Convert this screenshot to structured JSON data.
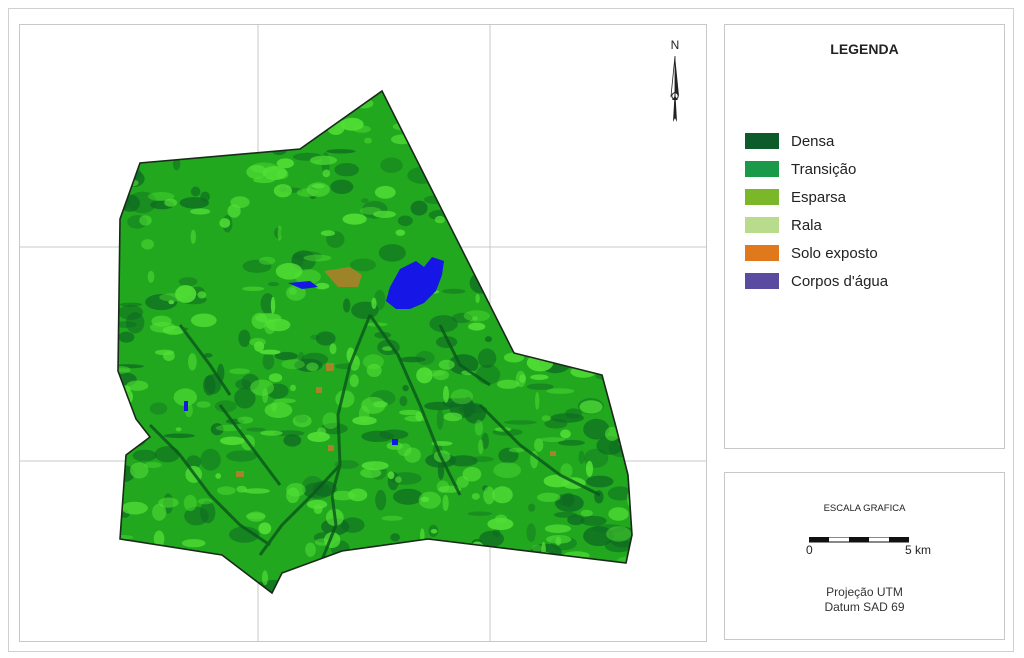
{
  "north_arrow": {
    "letter": "N"
  },
  "legend": {
    "title": "LEGENDA",
    "items": [
      {
        "label": "Densa",
        "color": "#0d5a2a"
      },
      {
        "label": "Transição",
        "color": "#1a9a48"
      },
      {
        "label": "Esparsa",
        "color": "#7ab829"
      },
      {
        "label": "Rala",
        "color": "#b8dc8c"
      },
      {
        "label": "Solo exposto",
        "color": "#e0781c"
      },
      {
        "label": "Corpos d'água",
        "color": "#5a4aa0"
      }
    ]
  },
  "scale": {
    "title": "ESCALA GRAFICA",
    "start_label": "0",
    "end_label": "5 km"
  },
  "projection": {
    "line1": "Projeção UTM",
    "line2": "Datum SAD 69"
  },
  "map_colors": {
    "base": "#21a81e",
    "dense": "#0e6a22",
    "light": "#52e036",
    "water": "#1616e6",
    "soil": "#c8782c",
    "outline": "#1a2a1a",
    "grid": "#c8c8c8"
  }
}
